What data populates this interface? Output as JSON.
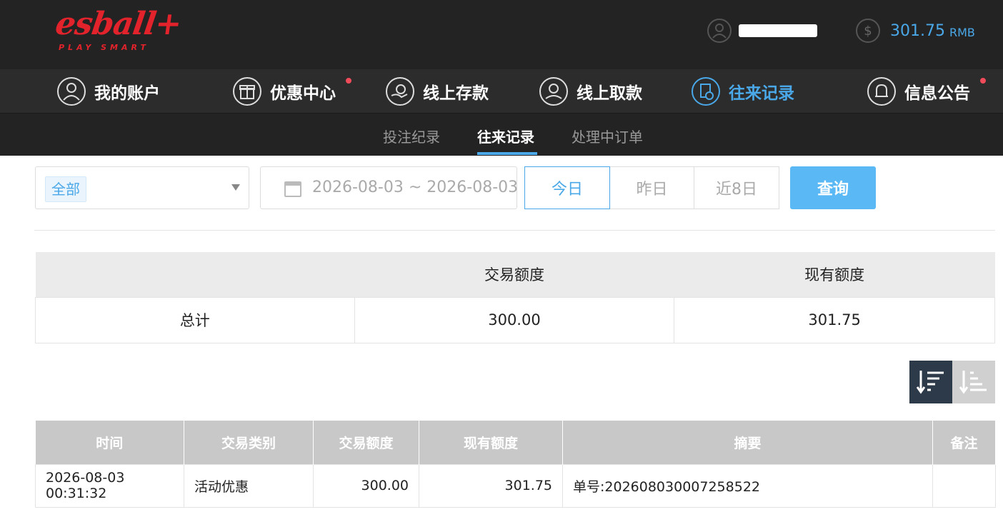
{
  "brand": {
    "logo_text": "esball+",
    "tagline": "PLAY SMART",
    "color": "#e3232b"
  },
  "account": {
    "username": "",
    "balance": "301.75",
    "currency": "RMB",
    "accent": "#4aa8e8"
  },
  "main_nav": [
    {
      "label": "我的账户",
      "icon": "user-icon"
    },
    {
      "label": "优惠中心",
      "icon": "gift-icon"
    },
    {
      "label": "线上存款",
      "icon": "deposit-icon"
    },
    {
      "label": "线上取款",
      "icon": "withdraw-icon"
    },
    {
      "label": "往来记录",
      "icon": "records-icon"
    },
    {
      "label": "信息公告",
      "icon": "bell-icon"
    }
  ],
  "sub_nav": [
    {
      "label": "投注纪录"
    },
    {
      "label": "往来记录"
    },
    {
      "label": "处理中订单"
    }
  ],
  "filter": {
    "type_selected": "全部",
    "date_range": "2026-08-03 ~ 2026-08-03",
    "range_buttons": [
      "今日",
      "昨日",
      "近8日"
    ],
    "query_label": "查询"
  },
  "summary": {
    "headers": [
      "",
      "交易额度",
      "现有额度"
    ],
    "row": {
      "label": "总计",
      "amount": "300.00",
      "balance": "301.75"
    }
  },
  "records": {
    "headers": [
      "时间",
      "交易类别",
      "交易额度",
      "现有额度",
      "摘要",
      "备注"
    ],
    "rows": [
      [
        "2026-08-03 00:31:32",
        "活动优惠",
        "300.00",
        "301.75",
        "单号:202608030007258522",
        ""
      ]
    ]
  }
}
